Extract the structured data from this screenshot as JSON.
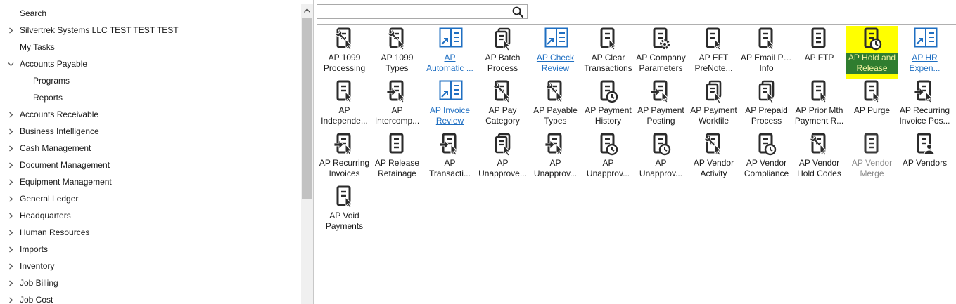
{
  "search_label": "Search",
  "tree": [
    {
      "label": "Silvertrek Systems LLC TEST TEST TEST",
      "chevron": "right",
      "indent": 0
    },
    {
      "label": "My Tasks",
      "chevron": "none",
      "indent": 0
    },
    {
      "label": "Accounts Payable",
      "chevron": "down",
      "indent": 0
    },
    {
      "label": "Programs",
      "chevron": "none",
      "indent": 1
    },
    {
      "label": "Reports",
      "chevron": "none",
      "indent": 1
    },
    {
      "label": "Accounts Receivable",
      "chevron": "right",
      "indent": 0
    },
    {
      "label": "Business Intelligence",
      "chevron": "right",
      "indent": 0
    },
    {
      "label": "Cash Management",
      "chevron": "right",
      "indent": 0
    },
    {
      "label": "Document Management",
      "chevron": "right",
      "indent": 0
    },
    {
      "label": "Equipment Management",
      "chevron": "right",
      "indent": 0
    },
    {
      "label": "General Ledger",
      "chevron": "right",
      "indent": 0
    },
    {
      "label": "Headquarters",
      "chevron": "right",
      "indent": 0
    },
    {
      "label": "Human Resources",
      "chevron": "right",
      "indent": 0
    },
    {
      "label": "Imports",
      "chevron": "right",
      "indent": 0
    },
    {
      "label": "Inventory",
      "chevron": "right",
      "indent": 0
    },
    {
      "label": "Job Billing",
      "chevron": "right",
      "indent": 0
    },
    {
      "label": "Job Cost",
      "chevron": "right",
      "indent": 0
    }
  ],
  "search": {
    "placeholder": "",
    "value": ""
  },
  "programs": [
    {
      "lines": [
        "AP 1099",
        "Processing"
      ],
      "icon": "doc-wrench-icon",
      "style": "normal"
    },
    {
      "lines": [
        "AP 1099",
        "Types"
      ],
      "icon": "doc-wrench-icon",
      "style": "normal"
    },
    {
      "lines": [
        "AP",
        "Automatic ..."
      ],
      "icon": "external-report-icon",
      "style": "link"
    },
    {
      "lines": [
        "AP Batch",
        "Process"
      ],
      "icon": "doc-batch-icon",
      "style": "normal"
    },
    {
      "lines": [
        "AP Check",
        "Review"
      ],
      "icon": "external-report-icon",
      "style": "link"
    },
    {
      "lines": [
        "AP Clear",
        "Transactions"
      ],
      "icon": "doc-cursor-icon",
      "style": "normal"
    },
    {
      "lines": [
        "AP Company",
        "Parameters"
      ],
      "icon": "doc-gear-icon",
      "style": "normal"
    },
    {
      "lines": [
        "AP EFT",
        "PreNote..."
      ],
      "icon": "doc-cursor-icon",
      "style": "normal"
    },
    {
      "lines": [
        "AP Email Pay",
        "Info"
      ],
      "icon": "doc-cursor-icon",
      "style": "normal"
    },
    {
      "lines": [
        "AP FTP",
        ""
      ],
      "icon": "doc-plain-icon",
      "style": "normal"
    },
    {
      "lines": [
        "AP Hold and",
        "Release"
      ],
      "icon": "doc-clock-icon",
      "style": "highlight"
    },
    {
      "lines": [
        "AP HR",
        "Expen..."
      ],
      "icon": "external-report-icon",
      "style": "link"
    },
    {
      "lines": [
        "AP",
        "Independe..."
      ],
      "icon": "doc-cursor-icon",
      "style": "normal"
    },
    {
      "lines": [
        "AP",
        "Intercomp..."
      ],
      "icon": "doc-arrow-icon",
      "style": "normal"
    },
    {
      "lines": [
        "AP Invoice",
        "Review"
      ],
      "icon": "external-report-icon",
      "style": "link"
    },
    {
      "lines": [
        "AP Pay",
        "Category"
      ],
      "icon": "doc-wrench-icon",
      "style": "normal"
    },
    {
      "lines": [
        "AP Payable",
        "Types"
      ],
      "icon": "doc-wrench-icon",
      "style": "normal"
    },
    {
      "lines": [
        "AP Payment",
        "History"
      ],
      "icon": "doc-clock-icon",
      "style": "normal"
    },
    {
      "lines": [
        "AP Payment",
        "Posting"
      ],
      "icon": "doc-arrow-icon",
      "style": "normal"
    },
    {
      "lines": [
        "AP Payment",
        "Workfile"
      ],
      "icon": "doc-batch-icon",
      "style": "normal"
    },
    {
      "lines": [
        "AP Prepaid",
        "Process"
      ],
      "icon": "doc-batch-icon",
      "style": "normal"
    },
    {
      "lines": [
        "AP Prior Mth",
        "Payment R..."
      ],
      "icon": "doc-cursor-icon",
      "style": "normal"
    },
    {
      "lines": [
        "AP Purge",
        ""
      ],
      "icon": "doc-cursor-icon",
      "style": "normal"
    },
    {
      "lines": [
        "AP Recurring",
        "Invoice Pos..."
      ],
      "icon": "doc-arrow-icon",
      "style": "normal"
    },
    {
      "lines": [
        "AP Recurring",
        "Invoices"
      ],
      "icon": "doc-arrow-icon",
      "style": "normal"
    },
    {
      "lines": [
        "AP Release",
        "Retainage"
      ],
      "icon": "doc-plain-icon",
      "style": "normal"
    },
    {
      "lines": [
        "AP",
        "Transacti..."
      ],
      "icon": "doc-arrow-icon",
      "style": "normal"
    },
    {
      "lines": [
        "AP",
        "Unapprove..."
      ],
      "icon": "doc-batch-icon",
      "style": "normal"
    },
    {
      "lines": [
        "AP",
        "Unapprov..."
      ],
      "icon": "doc-arrow-icon",
      "style": "normal"
    },
    {
      "lines": [
        "AP",
        "Unapprov..."
      ],
      "icon": "doc-clock-icon",
      "style": "normal"
    },
    {
      "lines": [
        "AP",
        "Unapprov..."
      ],
      "icon": "doc-clock-icon",
      "style": "normal"
    },
    {
      "lines": [
        "AP Vendor",
        "Activity"
      ],
      "icon": "doc-wrench-icon",
      "style": "normal"
    },
    {
      "lines": [
        "AP Vendor",
        "Compliance"
      ],
      "icon": "doc-clock-icon",
      "style": "normal"
    },
    {
      "lines": [
        "AP Vendor",
        "Hold Codes"
      ],
      "icon": "doc-wrench-icon",
      "style": "normal"
    },
    {
      "lines": [
        "AP Vendor",
        "Merge"
      ],
      "icon": "doc-plain-icon",
      "style": "dim"
    },
    {
      "lines": [
        "AP Vendors",
        ""
      ],
      "icon": "doc-person-icon",
      "style": "normal"
    },
    {
      "lines": [
        "AP Void",
        "Payments"
      ],
      "icon": "doc-cursor-icon",
      "style": "normal"
    }
  ],
  "colors": {
    "icon_dark": "#2b2b2b",
    "icon_link": "#1f6fc2",
    "highlight": "#ffff00",
    "highlight_label_bg": "#2f7d2f",
    "link_text": "#1f6fc2"
  }
}
